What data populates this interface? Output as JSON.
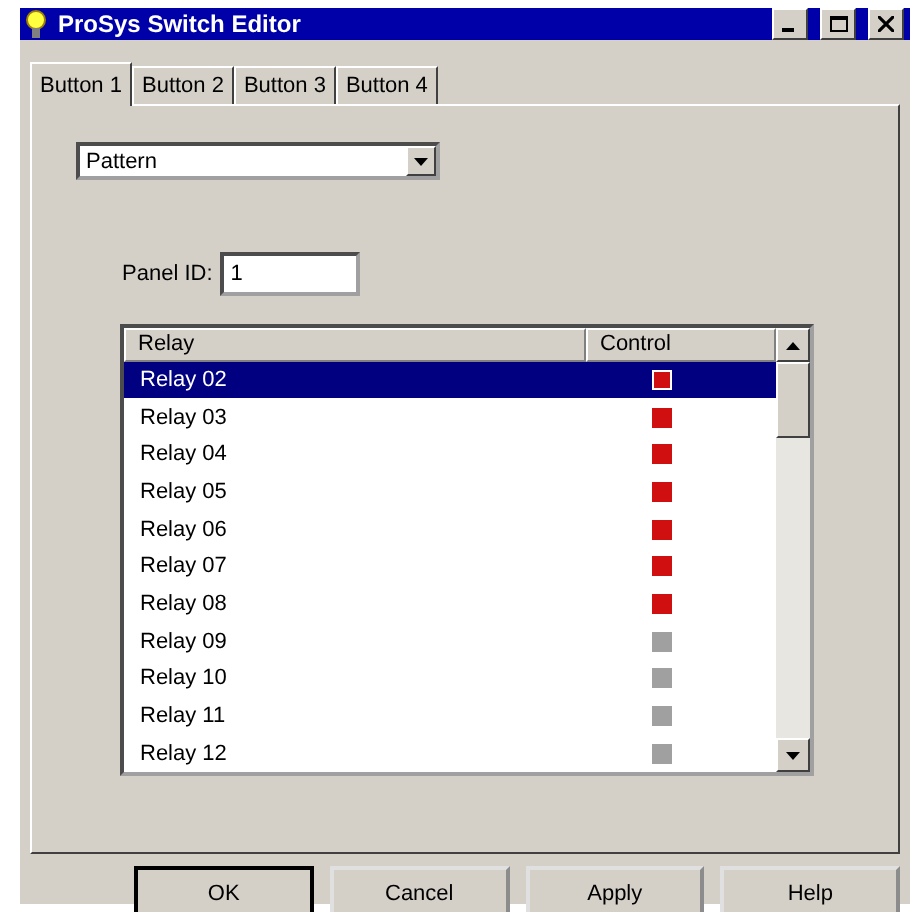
{
  "window": {
    "title": "ProSys Switch Editor"
  },
  "tabs": [
    {
      "label": "Button 1",
      "selected": true
    },
    {
      "label": "Button 2",
      "selected": false
    },
    {
      "label": "Button 3",
      "selected": false
    },
    {
      "label": "Button 4",
      "selected": false
    }
  ],
  "mode_dropdown": {
    "value": "Pattern"
  },
  "panel_id": {
    "label": "Panel ID:",
    "value": "1"
  },
  "relay_list": {
    "columns": [
      "Relay",
      "Control"
    ],
    "rows": [
      {
        "relay": "Relay 02",
        "on": true,
        "selected": true
      },
      {
        "relay": "Relay 03",
        "on": true,
        "selected": false
      },
      {
        "relay": "Relay 04",
        "on": true,
        "selected": false
      },
      {
        "relay": "Relay 05",
        "on": true,
        "selected": false
      },
      {
        "relay": "Relay 06",
        "on": true,
        "selected": false
      },
      {
        "relay": "Relay 07",
        "on": true,
        "selected": false
      },
      {
        "relay": "Relay 08",
        "on": true,
        "selected": false
      },
      {
        "relay": "Relay 09",
        "on": false,
        "selected": false
      },
      {
        "relay": "Relay 10",
        "on": false,
        "selected": false
      },
      {
        "relay": "Relay 11",
        "on": false,
        "selected": false
      },
      {
        "relay": "Relay 12",
        "on": false,
        "selected": false
      }
    ]
  },
  "buttons": [
    "OK",
    "Cancel",
    "Apply",
    "Help"
  ]
}
